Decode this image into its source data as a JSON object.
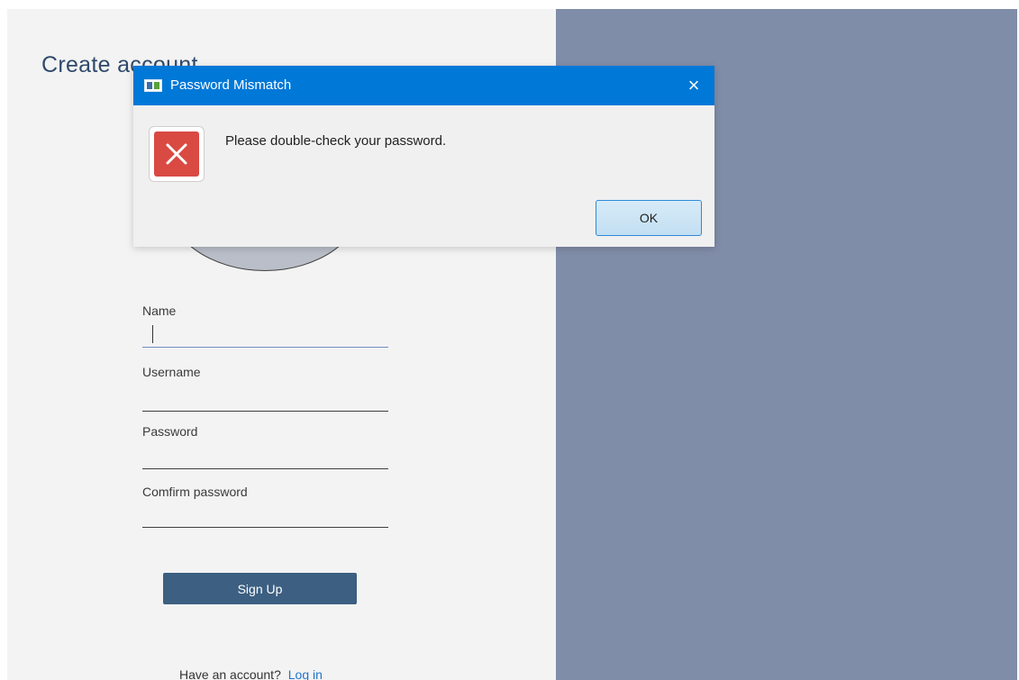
{
  "signup": {
    "title": "Create account",
    "fields": {
      "name_label": "Name",
      "name_value": "",
      "username_label": "Username",
      "username_value": "",
      "password_label": "Password",
      "password_value": "",
      "confirm_label": "Comfirm password",
      "confirm_value": ""
    },
    "signup_button": "Sign Up",
    "login_prompt": "Have an account?",
    "login_link": "Log in"
  },
  "dialog": {
    "title": "Password Mismatch",
    "message": "Please double-check your password.",
    "ok_label": "OK",
    "close_icon": "×",
    "icon": "error-icon"
  },
  "colors": {
    "side_panel": "#808da9",
    "titlebar": "#0078d7",
    "signup_button": "#3c5f82",
    "error_icon": "#d94a43",
    "link": "#1f74c9"
  }
}
